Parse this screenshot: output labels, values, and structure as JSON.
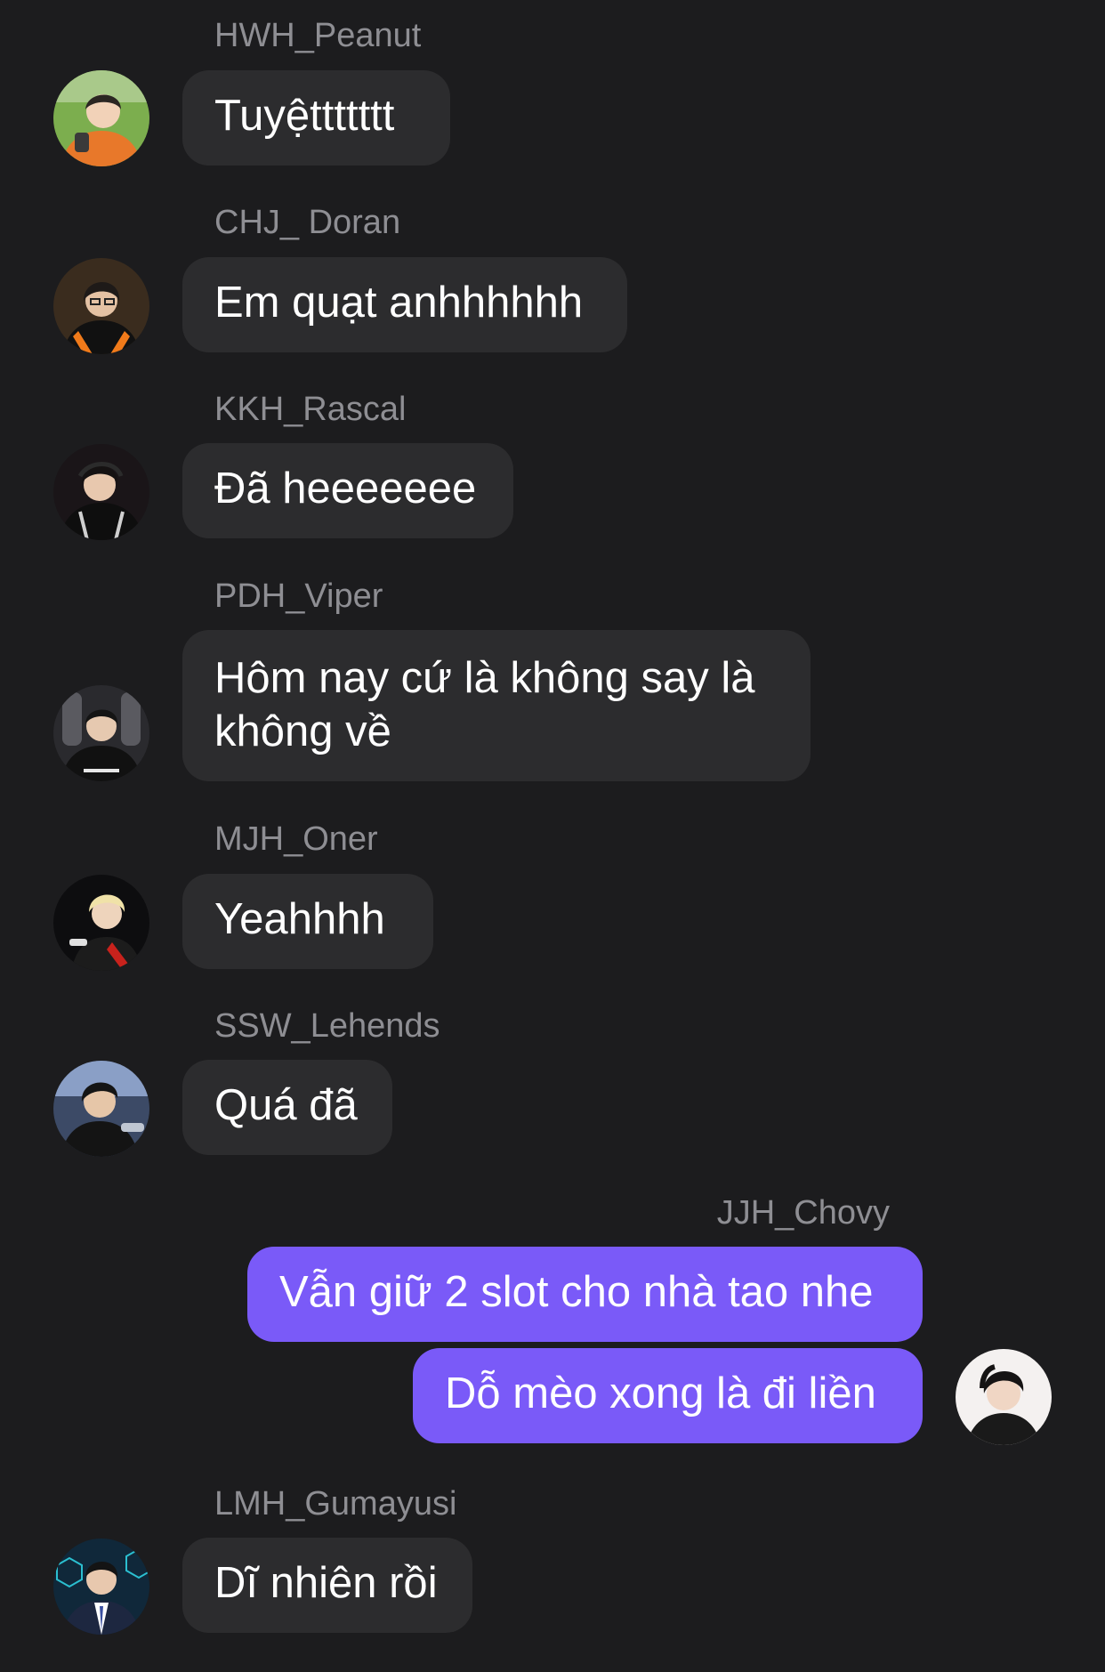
{
  "messages": [
    {
      "sender": "HWH_Peanut",
      "text": "Tuyệttttttt"
    },
    {
      "sender": "CHJ_ Doran",
      "text": "Em quạt anhhhhhh"
    },
    {
      "sender": "KKH_Rascal",
      "text": "Đã heeeeeee"
    },
    {
      "sender": "PDH_Viper",
      "text": "Hôm nay cứ là không say là không về"
    },
    {
      "sender": "MJH_Oner",
      "text": "Yeahhhh"
    },
    {
      "sender": "SSW_Lehends",
      "text": "Quá đã"
    },
    {
      "sender": "JJH_Chovy",
      "texts": [
        "Vẫn giữ 2 slot cho nhà tao nhe",
        "Dỗ mèo xong là đi liền"
      ]
    },
    {
      "sender": "LMH_Gumayusi",
      "text": "Dĩ nhiên rồi"
    }
  ],
  "colors": {
    "background": "#1c1c1e",
    "incoming_bubble": "#2c2c2e",
    "outgoing_bubble": "#7a5af8",
    "sender_name": "#8e8e93",
    "message_text": "#ffffff"
  }
}
